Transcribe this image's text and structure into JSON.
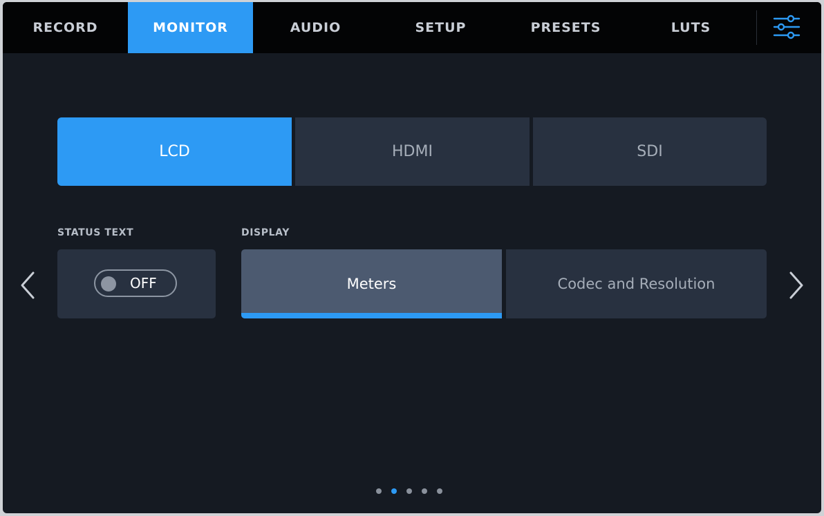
{
  "tabs": [
    {
      "label": "RECORD",
      "active": false
    },
    {
      "label": "MONITOR",
      "active": true
    },
    {
      "label": "AUDIO",
      "active": false
    },
    {
      "label": "SETUP",
      "active": false
    },
    {
      "label": "PRESETS",
      "active": false
    },
    {
      "label": "LUTS",
      "active": false
    }
  ],
  "menu_icon": "sliders-icon",
  "outputs": [
    {
      "label": "LCD",
      "active": true
    },
    {
      "label": "HDMI",
      "active": false
    },
    {
      "label": "SDI",
      "active": false
    }
  ],
  "status_text": {
    "label": "STATUS TEXT",
    "toggle_value": "OFF"
  },
  "display": {
    "label": "DISPLAY",
    "options": [
      {
        "label": "Meters",
        "selected": true
      },
      {
        "label": "Codec and Resolution",
        "selected": false
      }
    ]
  },
  "pagination": {
    "pages": 5,
    "current": 2
  },
  "colors": {
    "accent": "#2d9af4",
    "background": "#151a22",
    "tile": "#283140",
    "tile_selected": "#4c5a70"
  }
}
